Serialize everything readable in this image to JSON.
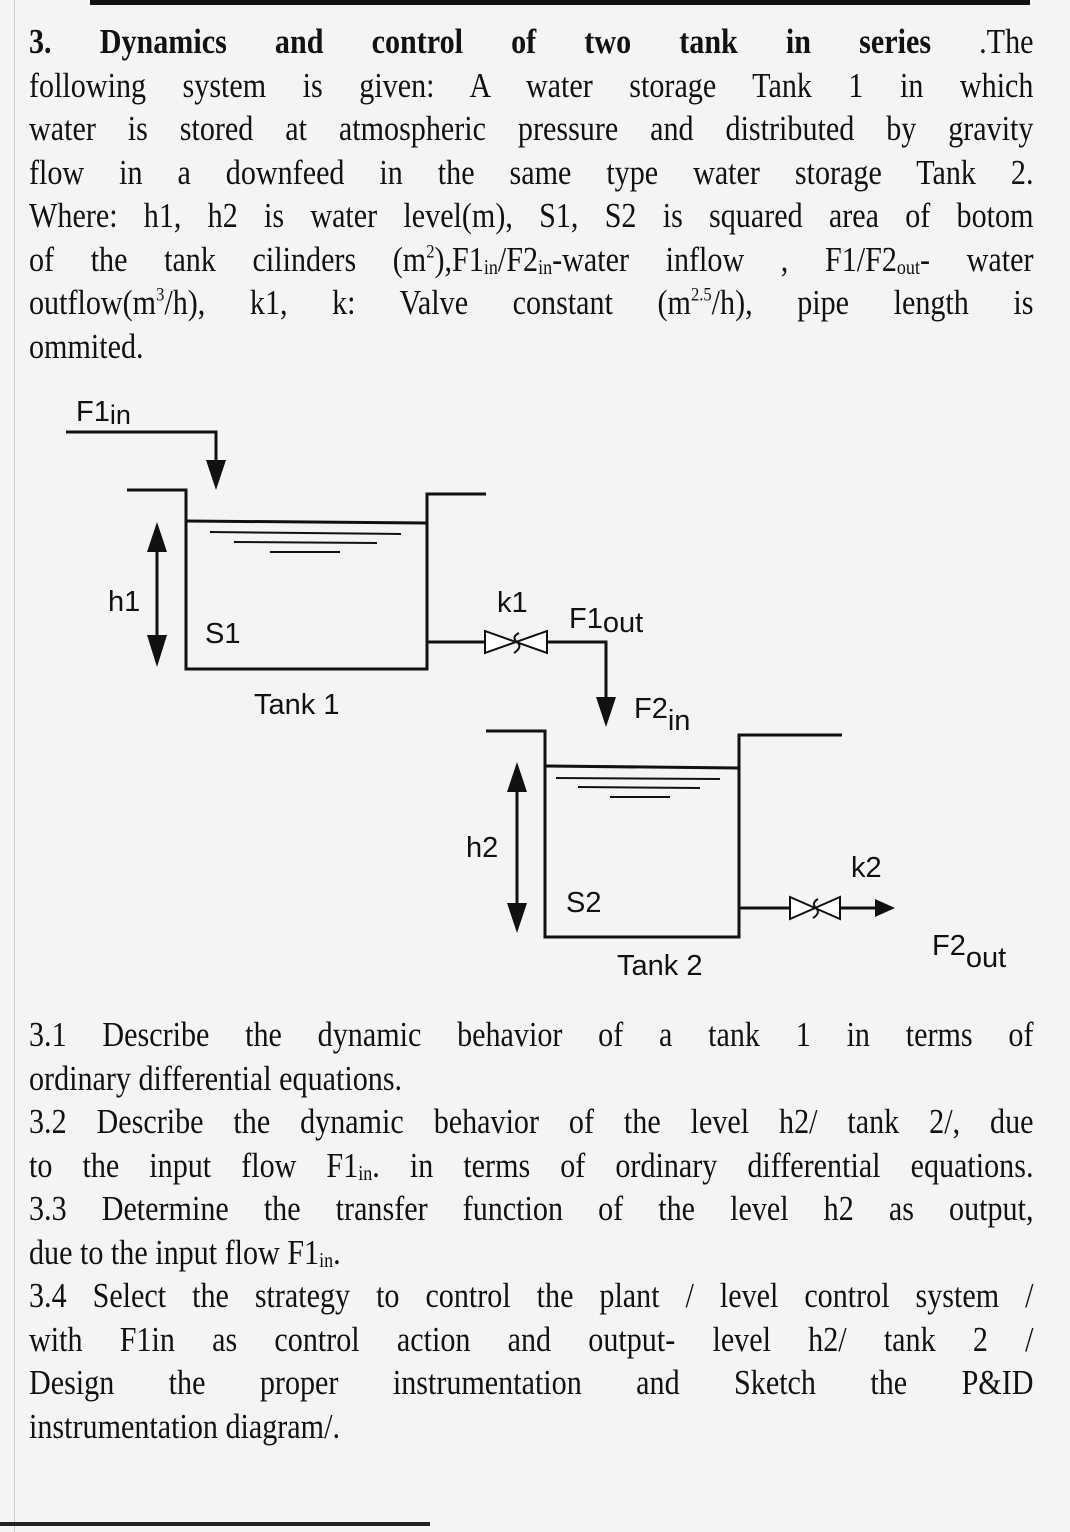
{
  "problem": {
    "number": "3.",
    "title": "Dynamics and control of two tank in series",
    "intro_lines": [
      [
        " .The"
      ],
      [
        "following system is given:  A water storage Tank 1 in which"
      ],
      [
        "water is stored at atmospheric pressure and distributed by gravity"
      ],
      [
        "flow in a downfeed  in  the same type water storage Tank 2."
      ],
      [
        "Where: h1, h2 is water level(m), S1, S2 is squared area of botom"
      ]
    ],
    "line6": {
      "a": "of the tank cilinders (m",
      "sup": "2",
      "b": "),F1",
      "sub1": "in",
      "c": "/F2",
      "sub2": "in",
      "d": "-water inflow , F1/F2",
      "sub3": "out",
      "e": "- water"
    },
    "line7": {
      "a": "outflow(m",
      "sup1": "3",
      "b": "/h), k1, k: Valve constant (m",
      "sup2": "2.5",
      "c": "/h),  pipe length is"
    },
    "line8": "ommited."
  },
  "diagram": {
    "f1in": {
      "main": "F1",
      "sub": "in"
    },
    "h1": "h1",
    "s1": "S1",
    "tank1": "Tank 1",
    "k1": "k1",
    "f1out": {
      "main": "F1",
      "sub": "out"
    },
    "f2in": {
      "main": "F2",
      "sub": "in"
    },
    "h2": "h2",
    "s2": "S2",
    "tank2": "Tank 2",
    "k2": "k2",
    "f2out": {
      "main": "F2",
      "sub": "out"
    }
  },
  "questions": {
    "q31": [
      "3.1 Describe the dynamic behavior of a tank 1 in terms of",
      "ordinary differential equations."
    ],
    "q32": {
      "l1": "3.2 Describe the dynamic behavior of the level h2/ tank 2/,  due",
      "l2a": "to the input flow F1",
      "l2sub": "in",
      "l2b": ". in terms of ordinary differential equations."
    },
    "q33": {
      "l1": "3.3 Determine the transfer function of the level h2 as output,",
      "l2a": "due to the input flow F1",
      "l2sub": "in",
      "l2b": "."
    },
    "q34": [
      "3.4 Select the strategy to control the plant / level control system /",
      "with F1in as control action  and  output- level  h2/ tank 2 /",
      "Design  the proper instrumentation and  Sketch the  P&ID",
      "instrumentation diagram/."
    ]
  }
}
